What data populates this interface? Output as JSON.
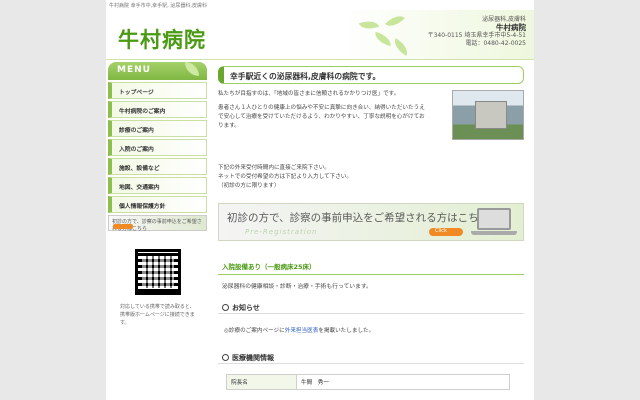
{
  "topline": "牛村病院 幸手市中,幸手駅, 泌尿器科,皮膚科",
  "header": {
    "logo": "牛村病院",
    "specialty": "泌尿器科,皮膚科",
    "hospital_name": "牛村病院",
    "address": "〒340-0115 埼玉県幸手市中5-4-51",
    "phone": "電話：0480-42-0025"
  },
  "sidebar": {
    "menu_label": "MENU",
    "items": [
      {
        "label": "トップページ"
      },
      {
        "label": "牛村病院のご案内"
      },
      {
        "label": "診療のご案内"
      },
      {
        "label": "入院のご案内"
      },
      {
        "label": "施設、設備など"
      },
      {
        "label": "地図、交通案内"
      },
      {
        "label": "個人情報保護方針"
      }
    ],
    "banner_text": "初診の方で、診察の事前申込をご希望される方はこちら",
    "qr_note": "対応している携帯で読み取ると、携帯版ホームページに接続できます。"
  },
  "main": {
    "title": "幸手駅近くの泌尿器科,皮膚科の病院です。",
    "intro_1": "私たちが目指すのは、「地域の皆さまに信頼されるかかりつけ医」です。",
    "intro_2": "患者さん１人ひとりの健康上の悩みや不安に真摯に向き合い、納得いただいたうえで安心して治療を受けていただけるよう、わかりやすい、丁寧な説明を心がけております。",
    "hours_1": "下記の外来受付時間内に直接ご来院下さい。",
    "hours_2": "ネットでの受付希望の方は下記より入力して下さい。",
    "hours_3": "（初診の方に限ります）",
    "reserve_text": "初診の方で、診察の事前申込をご希望される方はこちら",
    "reserve_eng": "Pre-Registration",
    "reserve_button": "Click",
    "inpatient": "入院設備あり（一般病床25床）",
    "services": "泌尿器科の健康相談・診断・治療・手術も行っています。",
    "notice_head": "お知らせ",
    "notice_pre": "診療のご案内ページに",
    "notice_link": "外来担当医表",
    "notice_post": "を掲載いたしました。",
    "medinfo_head": "医療機関情報",
    "table": [
      {
        "key": "院長名",
        "value": "牛間　秀一"
      }
    ]
  }
}
